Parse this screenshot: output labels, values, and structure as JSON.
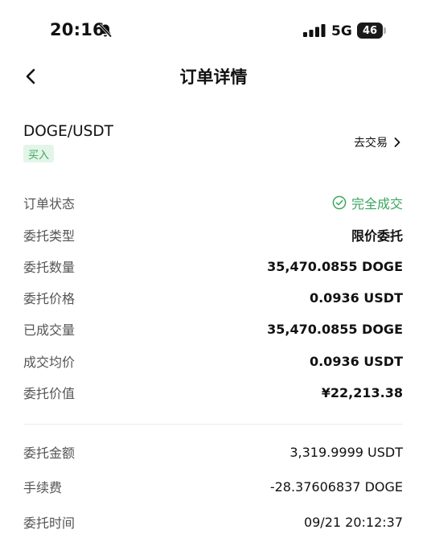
{
  "status_bar": {
    "time": "20:16",
    "network": "5G",
    "battery": "46",
    "icons": [
      "bell-slash-icon",
      "signal-bars-icon",
      "battery-icon"
    ]
  },
  "nav": {
    "title": "订单详情",
    "back_icon": "chevron-left-icon"
  },
  "order": {
    "pair": "DOGE/USDT",
    "side": "买入",
    "trade_link": "去交易",
    "trade_link_icon": "chevron-right-icon"
  },
  "details": [
    {
      "label": "订单状态",
      "value": "完全成交"
    },
    {
      "label": "委托类型",
      "value": "限价委托"
    },
    {
      "label": "委托数量",
      "value": "35,470.0855 DOGE"
    },
    {
      "label": "委托价格",
      "value": "0.0936 USDT"
    },
    {
      "label": "已成交量",
      "value": "35,470.0855 DOGE"
    },
    {
      "label": "成交均价",
      "value": "0.0936 USDT"
    },
    {
      "label": "委托价值",
      "value": "¥22,213.38"
    }
  ],
  "summary": [
    {
      "label": "委托金额",
      "value": "3,319.9999 USDT"
    },
    {
      "label": "手续费",
      "value": "-28.37606837 DOGE"
    },
    {
      "label": "委托时间",
      "value": "09/21 20:12:37"
    }
  ],
  "colors": {
    "accent_green": "#3aa65c",
    "badge_bg": "#e3f5e9",
    "label_gray": "#555555"
  }
}
